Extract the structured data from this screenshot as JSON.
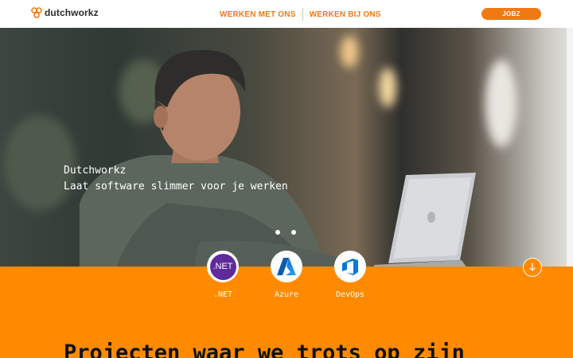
{
  "header": {
    "logo_text": "dutchworkz",
    "nav": [
      {
        "label": "WERKEN MET ONS"
      },
      {
        "label": "WERKEN BIJ ONS"
      }
    ],
    "cta_label": "JOBZ"
  },
  "hero": {
    "brand": "Dutchworkz",
    "tagline": "Laat software slimmer voor je werken",
    "slide_count": 2
  },
  "technologies": [
    {
      "label": ".NET",
      "badge": ".NET",
      "icon": "dotnet-icon"
    },
    {
      "label": "Azure",
      "icon": "azure-icon"
    },
    {
      "label": "DevOps",
      "icon": "devops-icon"
    }
  ],
  "section": {
    "title": "Projecten waar we trots op zijn"
  },
  "colors": {
    "accent": "#f07a12",
    "orange_background": "#ff8a00",
    "dotnet_purple": "#5e2a9c",
    "azure_blue": "#0a6fd6"
  }
}
